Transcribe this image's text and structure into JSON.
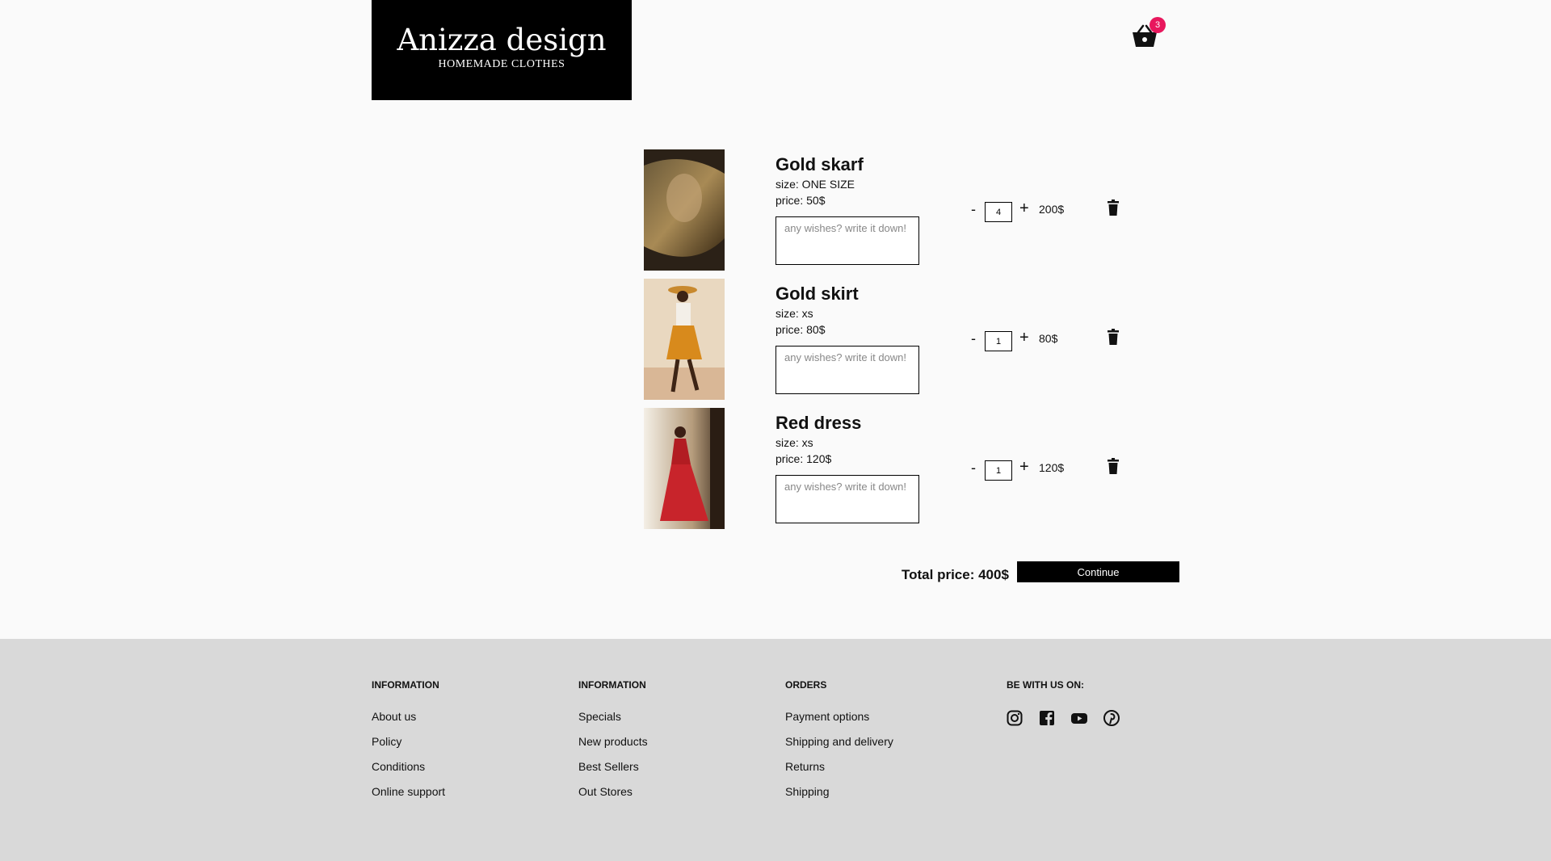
{
  "header": {
    "brand_name": "Anizza design",
    "brand_tagline": "HOMEMADE CLOTHES",
    "cart_count": "3"
  },
  "cart_items": [
    {
      "title": "Gold skarf",
      "size": "size: ONE SIZE",
      "price": "price: 50$",
      "wish_placeholder": "any wishes? write it down!",
      "quantity": "4",
      "total": "200$",
      "image": "scarf-photo"
    },
    {
      "title": "Gold skirt",
      "size": "size: xs",
      "price": "price: 80$",
      "wish_placeholder": "any wishes? write it down!",
      "quantity": "1",
      "total": "80$",
      "image": "skirt-photo"
    },
    {
      "title": "Red dress",
      "size": "size: xs",
      "price": "price: 120$",
      "wish_placeholder": "any wishes? write it down!",
      "quantity": "1",
      "total": "120$",
      "image": "dress-photo"
    }
  ],
  "controls": {
    "minus": "-",
    "plus": "+"
  },
  "summary": {
    "total_label": "Total price: 400$",
    "continue_label": "Continue"
  },
  "footer": {
    "col1": {
      "heading": "INFORMATION",
      "links": [
        "About us",
        "Policy",
        "Conditions",
        "Online support"
      ]
    },
    "col2": {
      "heading": "INFORMATION",
      "links": [
        "Specials",
        "New products",
        "Best Sellers",
        "Out Stores"
      ]
    },
    "col3": {
      "heading": "ORDERS",
      "links": [
        "Payment options",
        "Shipping and delivery",
        "Returns",
        "Shipping"
      ]
    },
    "col4": {
      "heading": "BE WITH US ON:",
      "icons": [
        "instagram-icon",
        "facebook-icon",
        "youtube-icon",
        "pinterest-icon"
      ]
    }
  },
  "colors": {
    "badge": "#e8175d",
    "footer_bg": "#d9d9d9",
    "page_bg": "#fafafa"
  }
}
